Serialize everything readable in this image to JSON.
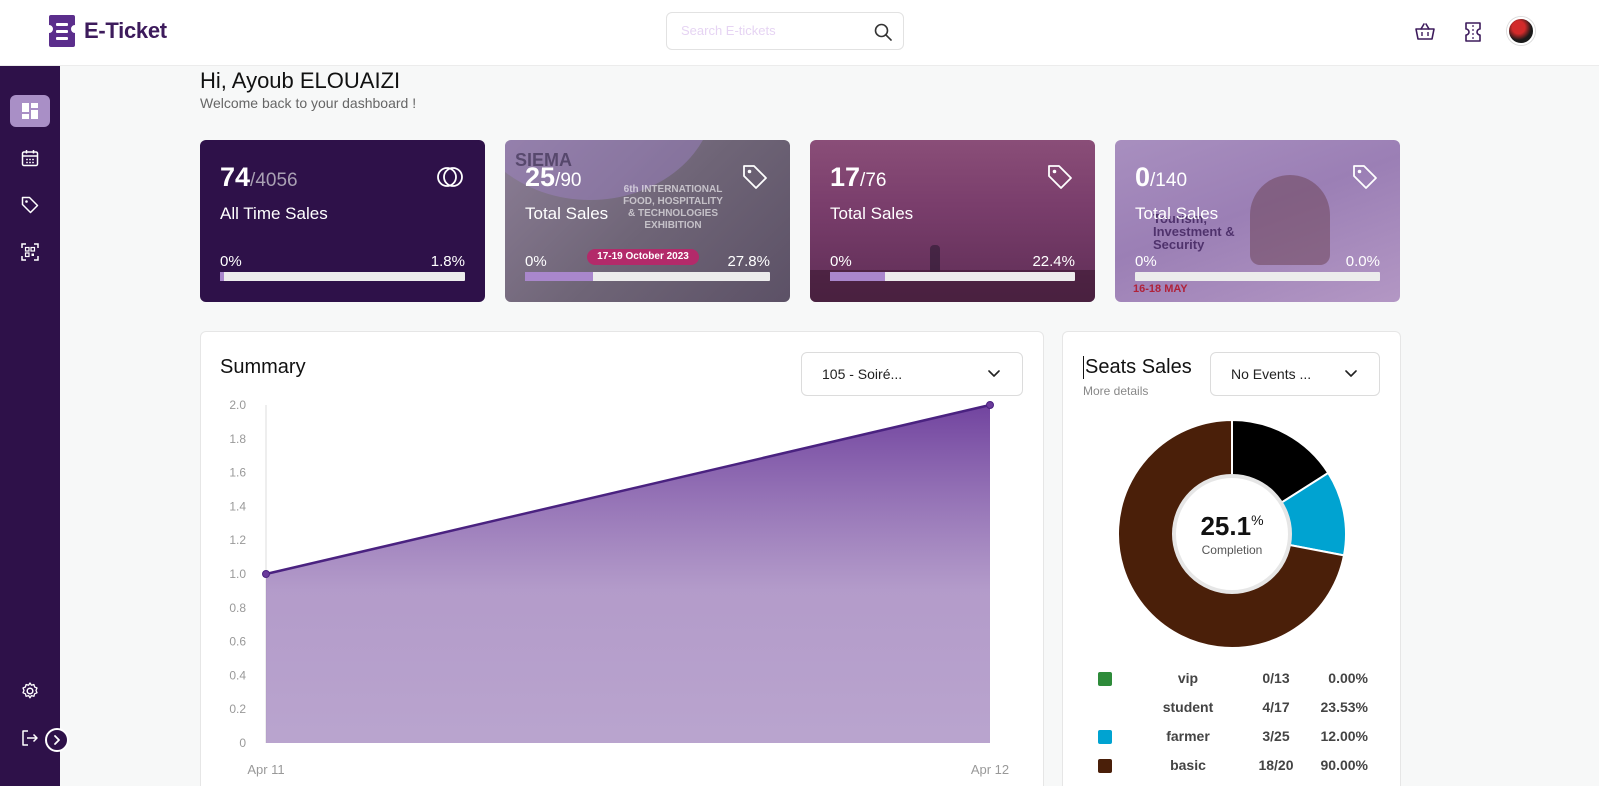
{
  "header": {
    "app_name": "E-Ticket",
    "search_placeholder": "Search E-tickets"
  },
  "greeting": {
    "title": "Hi, Ayoub ELOUAIZI",
    "subtitle": "Welcome back to your dashboard !"
  },
  "cards": [
    {
      "value": "74",
      "total": "/4056",
      "label": "All Time Sales",
      "min": "0%",
      "pct": "1.8%",
      "progress": 0.018
    },
    {
      "value": "25",
      "total": "/90",
      "label": "Total Sales",
      "min": "0%",
      "pct": "27.8%",
      "progress": 0.278,
      "banner_text": "17-19 October 2023",
      "poster_brand": "SIEMA",
      "poster_text": "6th INTERNATIONAL FOOD, HOSPITALITY & TECHNOLOGIES EXHIBITION"
    },
    {
      "value": "17",
      "total": "/76",
      "label": "Total Sales",
      "min": "0%",
      "pct": "22.4%",
      "progress": 0.224
    },
    {
      "value": "0",
      "total": "/140",
      "label": "Total Sales",
      "min": "0%",
      "pct": "0.0%",
      "progress": 0.0,
      "poster_text": "Tourism, Investment & Security",
      "poster_date": "16-18 MAY"
    }
  ],
  "summary": {
    "title": "Summary",
    "dropdown_label": "105 - Soiré..."
  },
  "seats": {
    "title": "Seats Sales",
    "more": "More details",
    "dropdown_label": "No Events ...",
    "completion_value": "25.1",
    "completion_unit": "%",
    "completion_label": "Completion",
    "legend": [
      {
        "name": "vip",
        "count": "0/13",
        "pct": "0.00%",
        "color": "#2e8b3a"
      },
      {
        "name": "student",
        "count": "4/17",
        "pct": "23.53%",
        "color": "#000000"
      },
      {
        "name": "farmer",
        "count": "3/25",
        "pct": "12.00%",
        "color": "#00a3d1"
      },
      {
        "name": "basic",
        "count": "18/20",
        "pct": "90.00%",
        "color": "#4a1f09"
      }
    ]
  },
  "chart_data": [
    {
      "type": "area",
      "title": "Summary",
      "x": [
        "Apr 11",
        "Apr 12"
      ],
      "values": [
        1.0,
        2.0
      ],
      "ylim": [
        0,
        2.0
      ],
      "yticks": [
        "0",
        "0.2",
        "0.4",
        "0.6",
        "0.8",
        "1.0",
        "1.2",
        "1.4",
        "1.6",
        "1.8",
        "2.0"
      ],
      "color": "#5b2e8c",
      "grid": false
    },
    {
      "type": "pie",
      "title": "Seats Sales",
      "categories": [
        "student",
        "farmer",
        "basic",
        "vip"
      ],
      "values": [
        4,
        3,
        18,
        0
      ],
      "colors": [
        "#000000",
        "#00a3d1",
        "#4a1f09",
        "#2e8b3a"
      ]
    }
  ]
}
